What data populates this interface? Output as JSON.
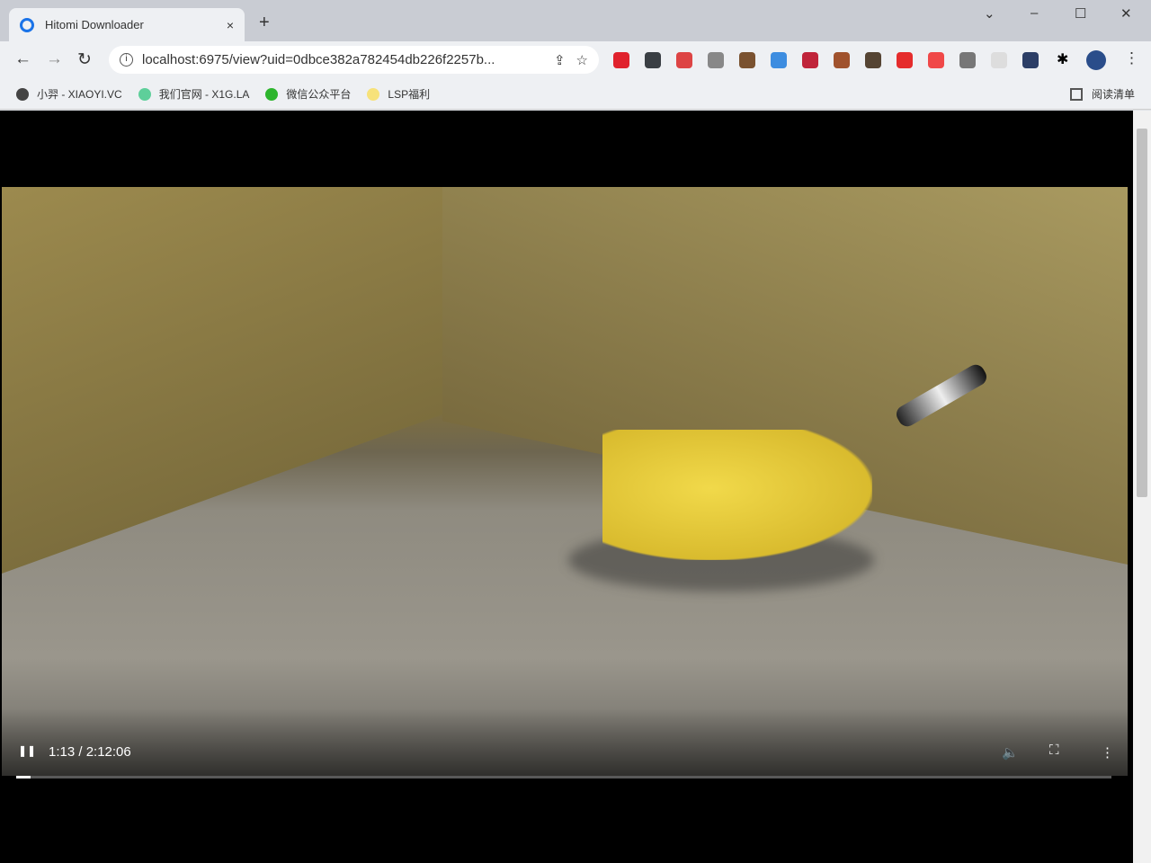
{
  "tab": {
    "title": "Hitomi Downloader",
    "close": "×",
    "new_tab": "+"
  },
  "window": {
    "dropdown": "⌄",
    "minimize": "–",
    "maximize": "☐",
    "close": "✕"
  },
  "nav": {
    "back": "←",
    "forward": "→",
    "reload": "↻"
  },
  "omnibox": {
    "info": "i",
    "url": "localhost:6975/view?uid=0dbce382a782454db226f2257b...",
    "share": "⇪",
    "star": "☆"
  },
  "extensions": [
    {
      "name": "opera-ext",
      "color": "#e0222d"
    },
    {
      "name": "dark-ext",
      "color": "#3a3f44"
    },
    {
      "name": "pen-ext",
      "color": "#d44"
    },
    {
      "name": "copy-ext",
      "color": "#888"
    },
    {
      "name": "coconut-ext",
      "color": "#7a5230"
    },
    {
      "name": "image-ext",
      "color": "#3d8de0"
    },
    {
      "name": "speed-ext",
      "color": "#c0243a"
    },
    {
      "name": "monkey-ext",
      "color": "#a0522d"
    },
    {
      "name": "cube-ext",
      "color": "#554433"
    },
    {
      "name": "alert-ext",
      "color": "#e52c2c"
    },
    {
      "name": "record-ext",
      "color": "#f04848"
    },
    {
      "name": "shield-ext",
      "color": "#777"
    },
    {
      "name": "folder-ext",
      "color": "#ddd"
    },
    {
      "name": "tool-ext",
      "color": "#2c3e66"
    }
  ],
  "menu": "⋮",
  "bookmarks": [
    {
      "label": "小羿 - XIAOYI.VC",
      "color": "#444"
    },
    {
      "label": "我们官网 - X1G.LA",
      "color": "#5ecf9a"
    },
    {
      "label": "微信公众平台",
      "color": "#2db52d"
    },
    {
      "label": "LSP福利",
      "color": "#f7e27a"
    }
  ],
  "reading_list": "阅读清单",
  "player": {
    "play_state": "❚❚",
    "time": "1:13 / 2:12:06",
    "volume": "🔈",
    "fullscreen": "⛶",
    "more": "⋮",
    "progress_percent": 0.9
  }
}
